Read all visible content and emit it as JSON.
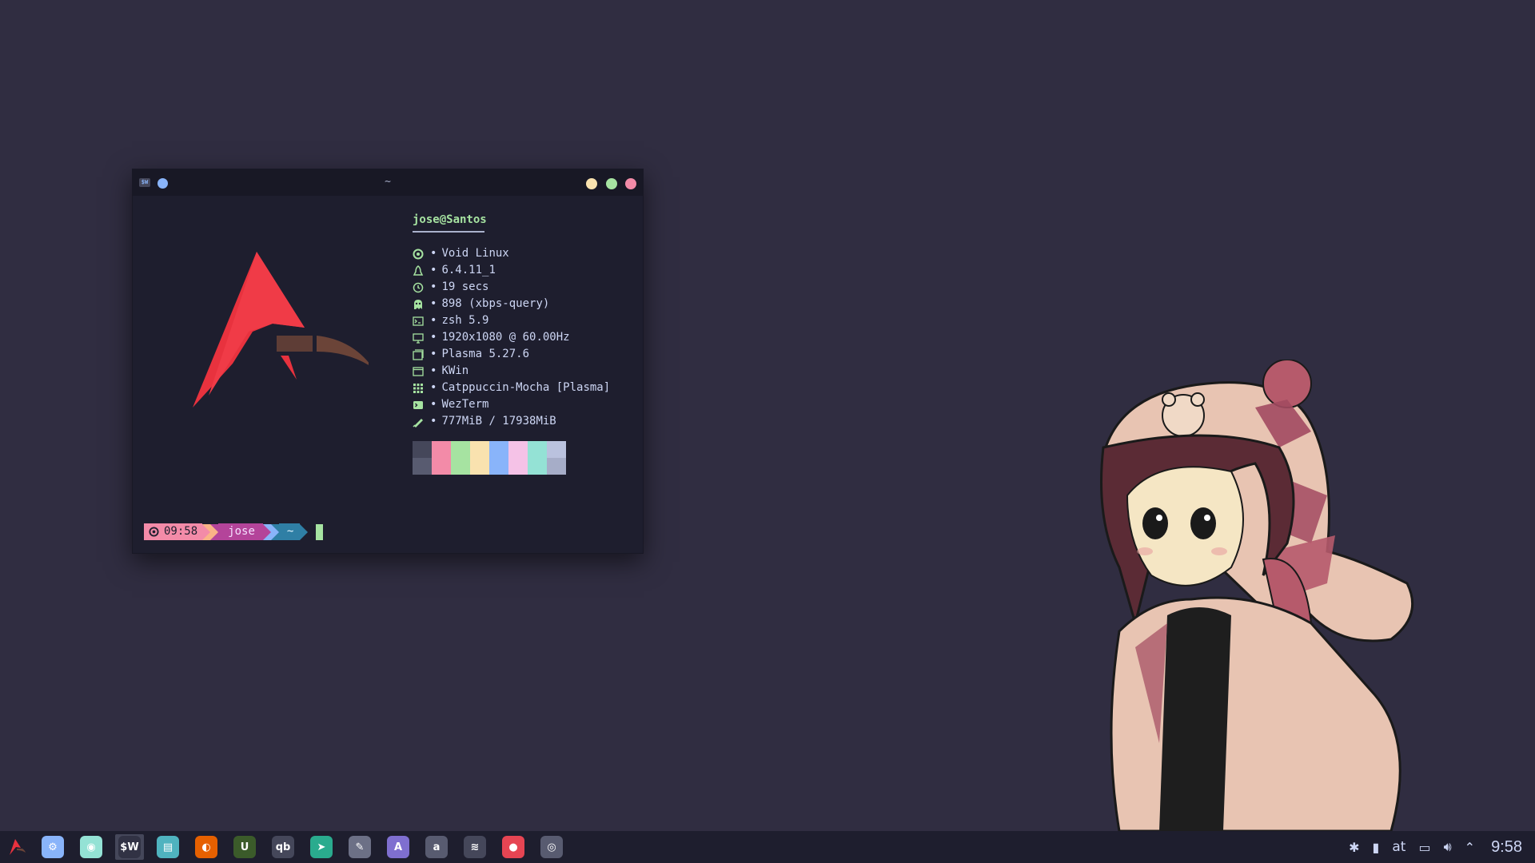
{
  "terminal": {
    "title": "~",
    "app_badge": "$W",
    "user_host": "jose@Santos",
    "info": [
      {
        "icon": "void-icon",
        "color": "#a6e3a1",
        "text": "Void Linux"
      },
      {
        "icon": "linux-penguin-icon",
        "color": "#a6e3a1",
        "text": "6.4.11_1"
      },
      {
        "icon": "clock-icon",
        "color": "#a6e3a1",
        "text": "19 secs"
      },
      {
        "icon": "ghost-package-icon",
        "color": "#a6e3a1",
        "text": "898 (xbps-query)"
      },
      {
        "icon": "shell-icon",
        "color": "#a6e3a1",
        "text": "zsh 5.9"
      },
      {
        "icon": "monitor-icon",
        "color": "#a6e3a1",
        "text": "1920x1080 @ 60.00Hz"
      },
      {
        "icon": "desktop-env-icon",
        "color": "#a6e3a1",
        "text": "Plasma 5.27.6"
      },
      {
        "icon": "window-manager-icon",
        "color": "#a6e3a1",
        "text": "KWin"
      },
      {
        "icon": "theme-icon",
        "color": "#a6e3a1",
        "text": "Catppuccin-Mocha [Plasma]"
      },
      {
        "icon": "terminal-icon",
        "color": "#a6e3a1",
        "text": "WezTerm"
      },
      {
        "icon": "memory-icon",
        "color": "#a6e3a1",
        "text": "777MiB / 17938MiB"
      }
    ],
    "separator": "•",
    "palette": [
      {
        "top": "#45475a",
        "bottom": "#585b70"
      },
      {
        "top": "#f38ba8",
        "bottom": "#f38ba8"
      },
      {
        "top": "#a6e3a1",
        "bottom": "#a6e3a1"
      },
      {
        "top": "#f9e2af",
        "bottom": "#f9e2af"
      },
      {
        "top": "#89b4fa",
        "bottom": "#89b4fa"
      },
      {
        "top": "#f5c2e7",
        "bottom": "#f5c2e7"
      },
      {
        "top": "#94e2d5",
        "bottom": "#94e2d5"
      },
      {
        "top": "#bac2de",
        "bottom": "#a6adc8"
      }
    ],
    "prompt": {
      "time": "09:58",
      "user": "jose",
      "dir": "~"
    }
  },
  "taskbar": {
    "apps": [
      {
        "name": "system-settings-icon",
        "bg": "#89b4fa",
        "glyph": "⚙"
      },
      {
        "name": "ghost-app-icon",
        "bg": "#94e2d5",
        "glyph": "◉"
      },
      {
        "name": "wezterm-icon",
        "bg": "#313244",
        "glyph": "$W",
        "active": true
      },
      {
        "name": "file-manager-icon",
        "bg": "#4fb3bf",
        "glyph": "▤"
      },
      {
        "name": "firefox-icon",
        "bg": "#e66000",
        "glyph": "◐"
      },
      {
        "name": "upscayl-icon",
        "bg": "#3b5b2a",
        "glyph": "U"
      },
      {
        "name": "qbittorrent-icon",
        "bg": "#45475a",
        "glyph": "qb"
      },
      {
        "name": "telegram-icon",
        "bg": "#2aab8e",
        "glyph": "➤"
      },
      {
        "name": "gimp-icon",
        "bg": "#6c7086",
        "glyph": "✎"
      },
      {
        "name": "font-app-icon",
        "bg": "#7f6fd0",
        "glyph": "A"
      },
      {
        "name": "anki-icon",
        "bg": "#585b70",
        "glyph": "a"
      },
      {
        "name": "audio-app-icon",
        "bg": "#45475a",
        "glyph": "≋"
      },
      {
        "name": "screen-recorder-icon",
        "bg": "#e64553",
        "glyph": "●"
      },
      {
        "name": "disks-icon",
        "bg": "#585b70",
        "glyph": "◎"
      }
    ],
    "tray": {
      "keyboard_layout": "at",
      "clock": "9:58"
    }
  }
}
